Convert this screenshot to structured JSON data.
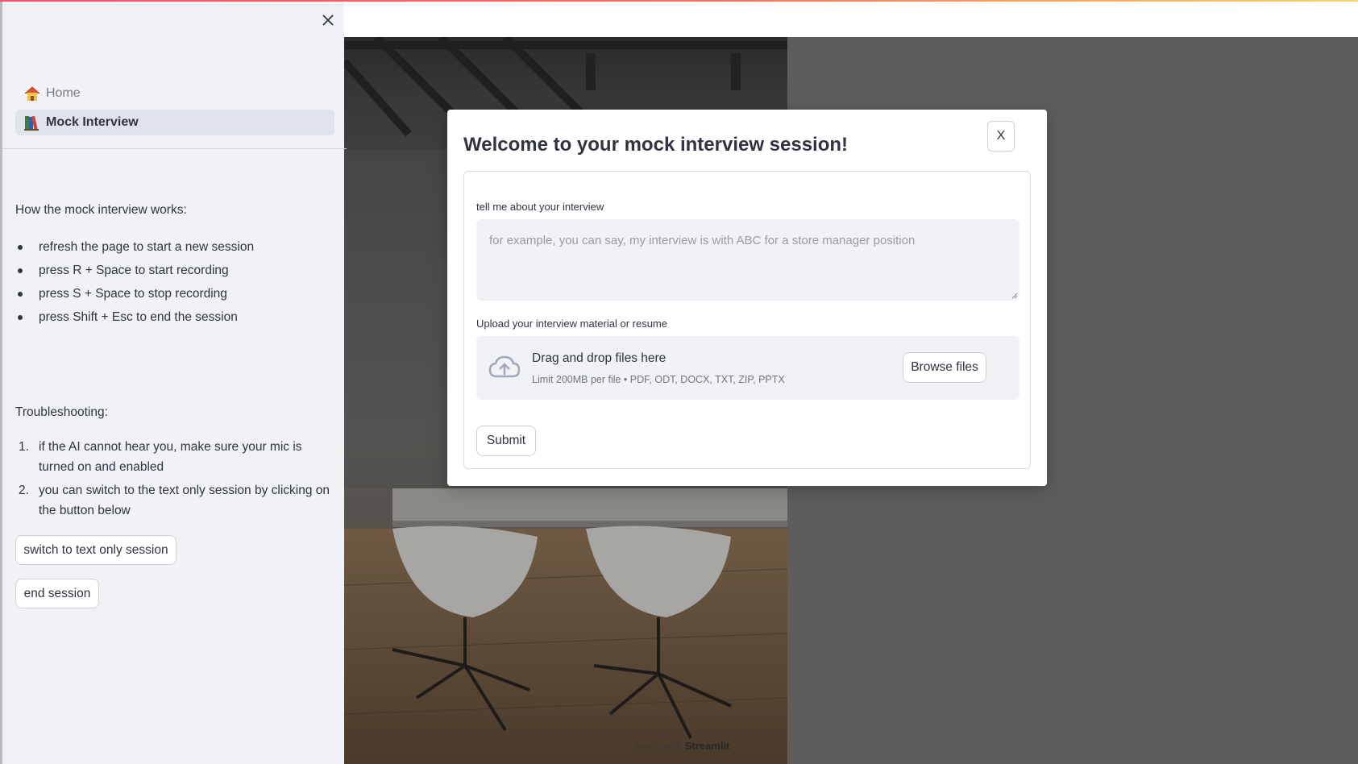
{
  "sidebar": {
    "nav": [
      {
        "label": "Home",
        "icon": "house-icon",
        "active": false
      },
      {
        "label": "Mock Interview",
        "icon": "books-icon",
        "active": true
      }
    ],
    "how_heading": "How the mock interview works:",
    "how_items": [
      "refresh the page to start a new session",
      "press R + Space to start recording",
      "press S + Space to stop recording",
      "press Shift + Esc to end the session"
    ],
    "trouble_heading": "Troubleshooting:",
    "trouble_items": [
      {
        "num": "1.",
        "text": "if the AI cannot hear you, make sure your mic is turned on and enabled"
      },
      {
        "num": "2.",
        "text": "you can switch to the text only session by clicking on the button below"
      }
    ],
    "switch_button": "switch to text only session",
    "end_button": "end session"
  },
  "modal": {
    "title": "Welcome to your mock interview session!",
    "close_label": "X",
    "interview_label": "tell me about your interview",
    "interview_placeholder": "for example, you can say, my interview is with ABC for a store manager position",
    "upload_label": "Upload your interview material or resume",
    "drop_text": "Drag and drop files here",
    "limit_text": "Limit 200MB per file • PDF, ODT, DOCX, TXT, ZIP, PPTX",
    "browse_button": "Browse files",
    "submit_button": "Submit"
  },
  "footer": {
    "made_with": "Made with",
    "brand": "Streamlit"
  },
  "colors": {
    "sidebar_bg": "#f0f2f6",
    "text": "#31333f",
    "gradient_start": "#ff4b6b",
    "gradient_end": "#ffd36b"
  }
}
